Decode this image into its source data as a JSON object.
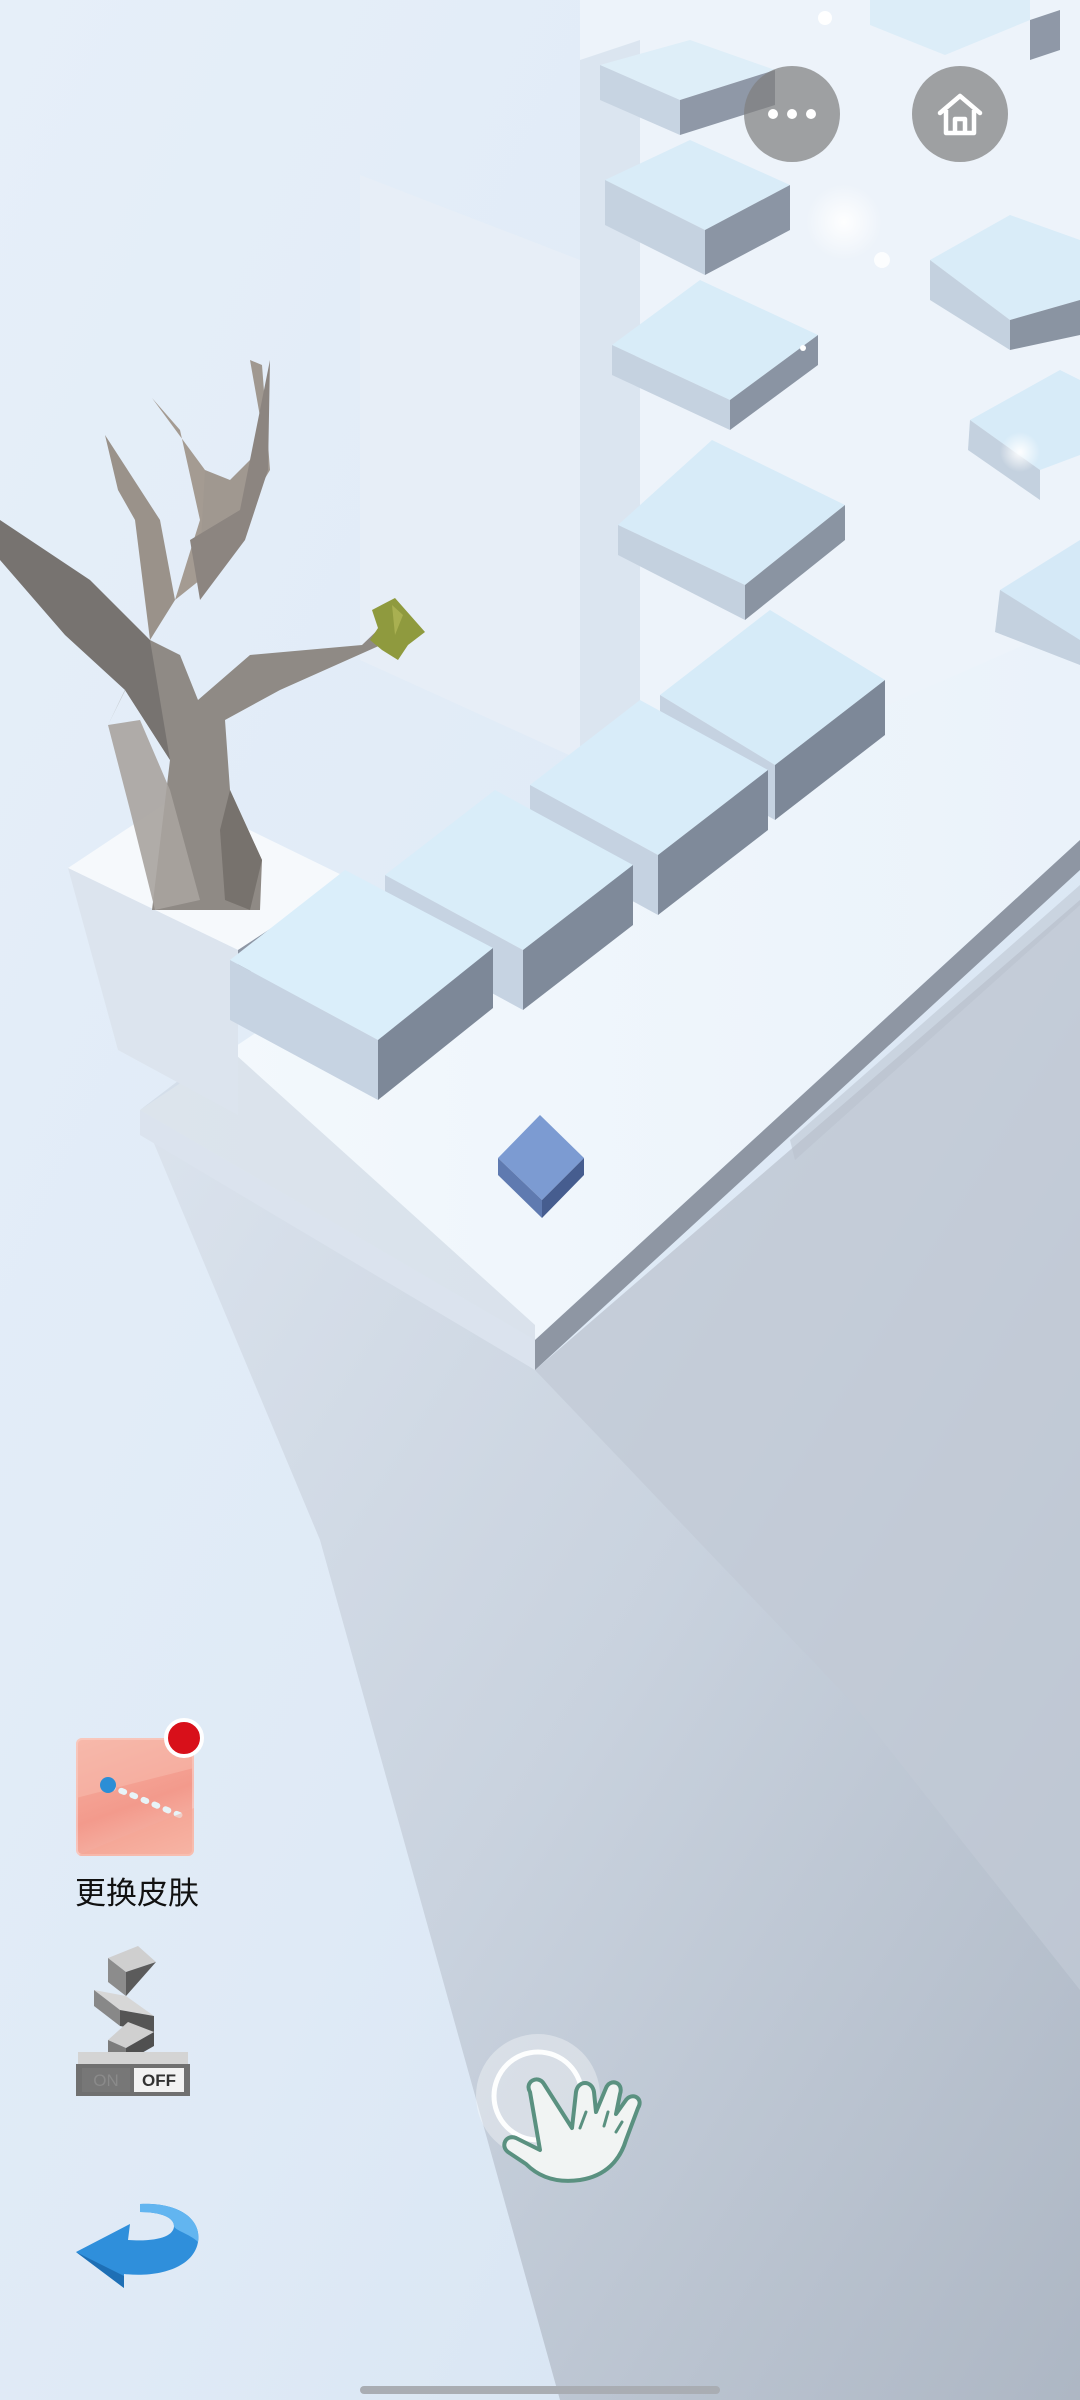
{
  "top_bar": {
    "more_icon": "more-horizontal-icon",
    "home_icon": "home-icon"
  },
  "side_controls": {
    "skin": {
      "label": "更换皮肤",
      "has_notification": true,
      "badge_color": "#d8101a"
    },
    "snake_toggle": {
      "on_label": "ON",
      "off_label": "OFF",
      "state": "off"
    },
    "back_icon": "back-arrow-icon"
  },
  "gameplay": {
    "tap_hint_icon": "tap-hand-icon",
    "player_color": "#6f8fc9",
    "tile_color": "#d7ecf8"
  }
}
